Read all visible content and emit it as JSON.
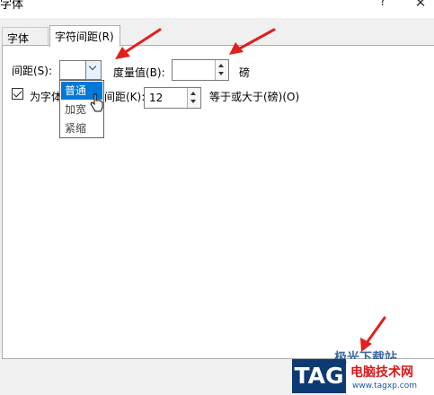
{
  "window": {
    "title": "字体",
    "help_glyph": "?",
    "close_glyph": "✕"
  },
  "tabs": [
    {
      "label": "字体(N)",
      "active": false
    },
    {
      "label": "字符间距(R)",
      "active": true
    }
  ],
  "spacing": {
    "label": "间距(S):",
    "value": "",
    "options": [
      "普通",
      "加宽",
      "紧缩"
    ],
    "highlighted": "普通"
  },
  "measure": {
    "label": "度量值(B):",
    "value": "",
    "unit": "磅"
  },
  "kerning": {
    "checked": true,
    "label_left": "为字体",
    "label_right": "间距(K):",
    "value": "12",
    "suffix": "等于或大于(磅)(O)"
  },
  "watermark": {
    "tag": "TAG",
    "site_name": "电脑技术网",
    "url": "www.tagxp.com",
    "top_text": "极光下载站"
  },
  "colors": {
    "arrow": "#e0201f",
    "selection": "#0078d7",
    "watermark_blue": "#0d3a72",
    "watermark_red": "#d71a1a"
  }
}
